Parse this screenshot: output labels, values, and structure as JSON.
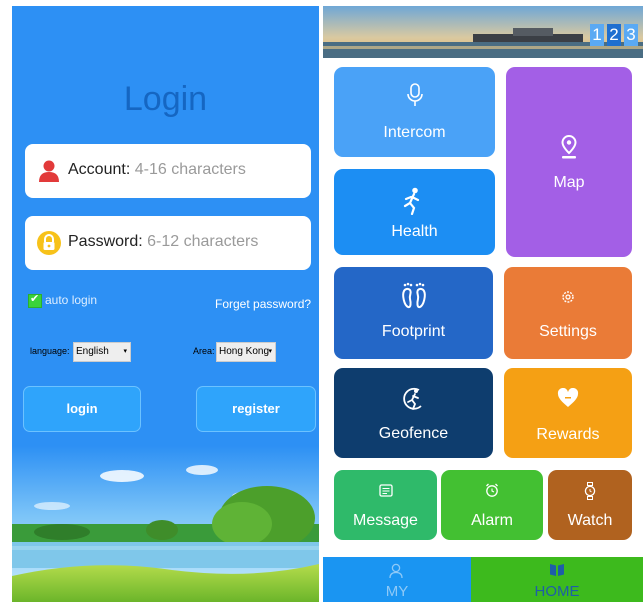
{
  "login": {
    "title": "Login",
    "account_label": "Account:",
    "account_placeholder": "4-16 characters",
    "password_label": "Password:",
    "password_placeholder": "6-12 characters",
    "auto_login_label": "auto login",
    "auto_login_checked": true,
    "forget_password": "Forget password?",
    "language_label": "language:",
    "language_value": "English",
    "area_label": "Area:",
    "area_value": "Hong Kong",
    "login_button": "login",
    "register_button": "register"
  },
  "home": {
    "banner_pages": [
      "1",
      "2",
      "3"
    ],
    "active_page": "2",
    "tiles": {
      "intercom": "Intercom",
      "map": "Map",
      "health": "Health",
      "footprint": "Footprint",
      "settings": "Settings",
      "geofence": "Geofence",
      "rewards": "Rewards",
      "message": "Message",
      "alarm": "Alarm",
      "watch": "Watch"
    },
    "nav": {
      "my": "MY",
      "home": "HOME"
    }
  },
  "colors": {
    "login_bg": "#2d90f4",
    "intercom": "#4aa2f7",
    "map": "#a35fe6",
    "health": "#1c8ef3",
    "footprint": "#2467c7",
    "settings": "#ea7b37",
    "geofence": "#0e3d6e",
    "rewards": "#f5a014",
    "message": "#2fba6a",
    "alarm": "#43c032",
    "watch": "#b0621f",
    "nav_my": "#1a95f2",
    "nav_home": "#3dba1d"
  },
  "icons": [
    "user-icon",
    "lock-icon",
    "checkbox-icon",
    "dropdown-arrow-icon",
    "microphone-icon",
    "map-pin-icon",
    "runner-icon",
    "footprints-icon",
    "gear-icon",
    "geofence-runner-icon",
    "heart-icon",
    "message-icon",
    "alarm-clock-icon",
    "watch-icon",
    "person-icon",
    "book-icon"
  ]
}
